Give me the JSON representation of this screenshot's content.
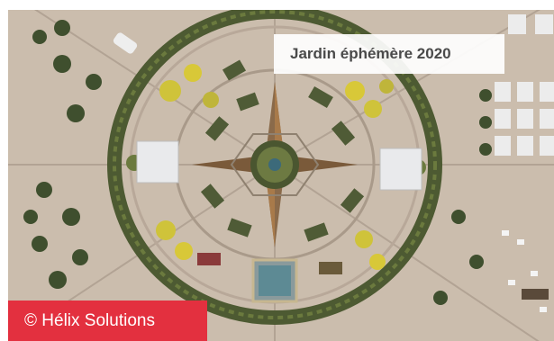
{
  "caption": {
    "title": "Jardin éphémère 2020",
    "credit": "© Hélix Solutions"
  },
  "image": {
    "subject": "aerial-garden-photo"
  },
  "colors": {
    "pavement": "#cdbfb1",
    "hedge": "#4d5a32",
    "flowers": "#d8c838",
    "star": "#7a5a3a",
    "credit_bg": "#e3303f",
    "title_bg": "#ffffff"
  }
}
